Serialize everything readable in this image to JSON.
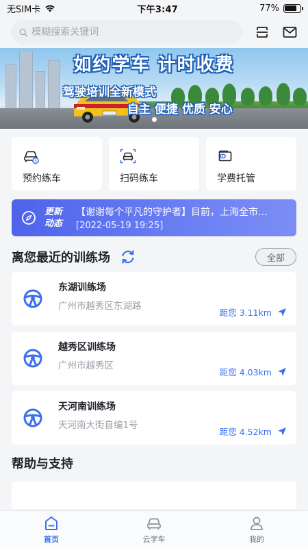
{
  "status_bar": {
    "carrier": "无SIM卡",
    "time": "下午3:47",
    "battery": "77%",
    "battery_level": 0.77
  },
  "header": {
    "search_placeholder": "模糊搜索关键词",
    "icons": [
      "search-icon",
      "scan-icon",
      "mail-icon"
    ]
  },
  "banner": {
    "title": "如约学车 计时收费",
    "subtitle": "驾驶培训全新模式",
    "slogan": "自主 便捷 优质 安心",
    "page_count": 1,
    "active_index": 0
  },
  "features": [
    {
      "label": "预约练车",
      "icon": "car-clock-icon"
    },
    {
      "label": "扫码练车",
      "icon": "scan-car-icon"
    },
    {
      "label": "学费托管",
      "icon": "wallet-icon"
    }
  ],
  "news": {
    "tag": "更新动态",
    "headline": "【谢谢每个平凡的守护者】目前，上海全市…",
    "date": "[2022-05-19 19:25]"
  },
  "nearby": {
    "title": "离您最近的训练场",
    "all_label": "全部",
    "items": [
      {
        "name": "东湖训练场",
        "address": "广州市越秀区东湖路",
        "distance": "距您 3.11km"
      },
      {
        "name": "越秀区训练场",
        "address": "广州市越秀区",
        "distance": "距您 4.03km"
      },
      {
        "name": "天河南训练场",
        "address": "天河南大街自编1号",
        "distance": "距您 4.52km"
      }
    ]
  },
  "help": {
    "title": "帮助与支持"
  },
  "tabbar": {
    "tabs": [
      {
        "label": "首页",
        "icon": "home-icon",
        "active": true
      },
      {
        "label": "云学车",
        "icon": "car-icon",
        "active": false
      },
      {
        "label": "我的",
        "icon": "user-icon",
        "active": false
      }
    ]
  },
  "colors": {
    "accent": "#3b6ff0",
    "news_gradient_start": "#4e63ea",
    "news_gradient_end": "#7b8df5",
    "page_bg": "#f4f5f7"
  }
}
